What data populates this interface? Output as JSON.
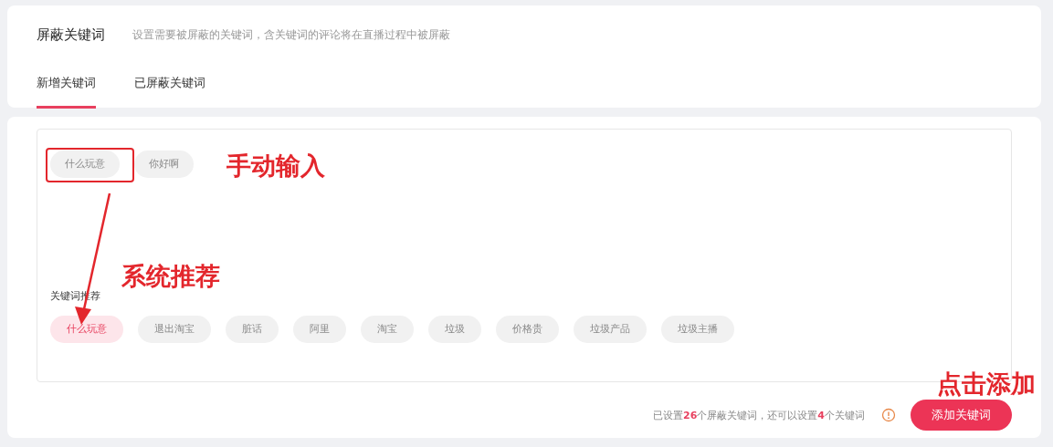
{
  "header": {
    "title": "屏蔽关键词",
    "description": "设置需要被屏蔽的关键词，含关键词的评论将在直播过程中被屏蔽"
  },
  "tabs": [
    {
      "label": "新增关键词",
      "selected": true
    },
    {
      "label": "已屏蔽关键词",
      "selected": false
    }
  ],
  "entered_keywords": [
    "什么玩意",
    "你好啊"
  ],
  "recommend_label": "关键词推荐",
  "recommended_keywords": [
    {
      "label": "什么玩意",
      "selected": true
    },
    {
      "label": "退出淘宝",
      "selected": false
    },
    {
      "label": "脏话",
      "selected": false
    },
    {
      "label": "阿里",
      "selected": false
    },
    {
      "label": "淘宝",
      "selected": false
    },
    {
      "label": "垃圾",
      "selected": false
    },
    {
      "label": "价格贵",
      "selected": false
    },
    {
      "label": "垃圾产品",
      "selected": false
    },
    {
      "label": "垃圾主播",
      "selected": false
    }
  ],
  "footer": {
    "summary": "已设置**26**个屏蔽关键词，还可以设置**4**个关键词",
    "button": "添加关键词"
  },
  "annotations": [
    {
      "text": "手动输入",
      "kind": "label"
    },
    {
      "text": "系统推荐",
      "kind": "label"
    },
    {
      "text": "点击添加",
      "kind": "label"
    }
  ]
}
